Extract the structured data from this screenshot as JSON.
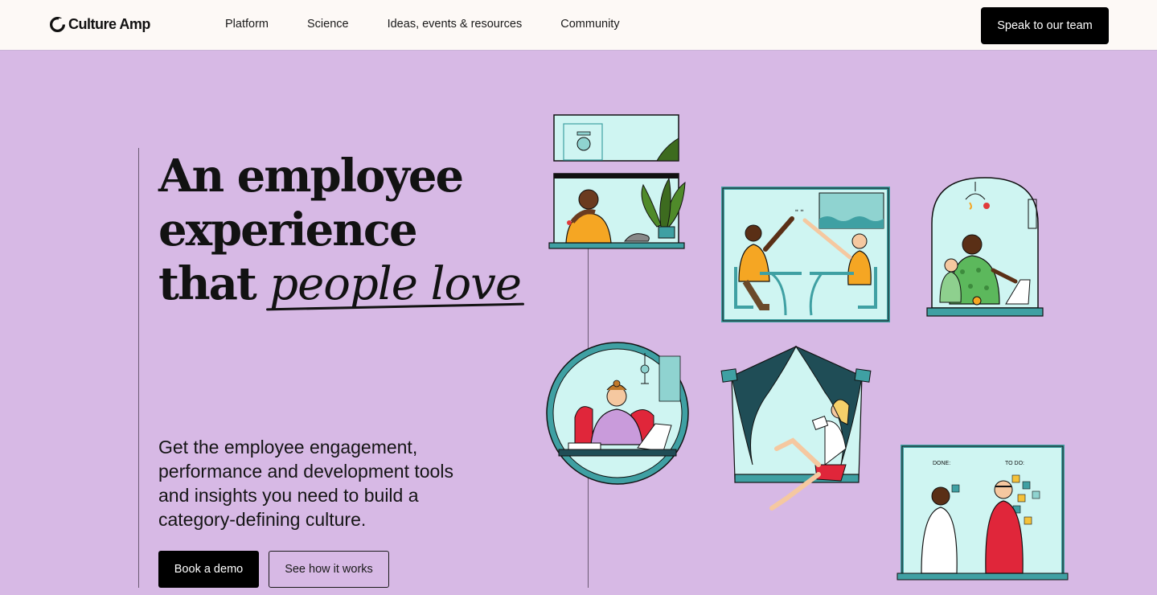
{
  "header": {
    "logo_text": "Culture Amp",
    "nav": [
      "Platform",
      "Science",
      "Ideas, events & resources",
      "Community"
    ],
    "cta_label": "Speak to our team"
  },
  "hero": {
    "headline_line1": "An employee",
    "headline_line2": "experience",
    "headline_line3_prefix": "that",
    "headline_script": "people love",
    "subcopy": "Get the employee engagement, performance and development tools and insights you need to build a category-defining culture.",
    "primary_button": "Book a demo",
    "secondary_button": "See how it works"
  },
  "illustrations": {
    "sticky_board_done": "DONE:",
    "sticky_board_todo": "TO DO:"
  },
  "colors": {
    "background": "#d7b9e5",
    "header_bg": "#fdf9f6",
    "teal": "#3fa0a3",
    "mint": "#cff5f2",
    "dark": "#000000"
  }
}
